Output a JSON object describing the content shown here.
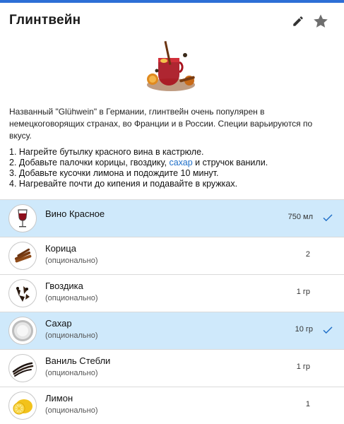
{
  "header": {
    "title": "Глинтвейн",
    "edit_icon": "pencil-icon",
    "star_icon": "star-icon"
  },
  "hero_image": "mulled-wine-photo",
  "description": "Названный \"Glühwein\" в Германии, глинтвейн очень популярен в немецкоговорящих странах, во Франции и в России. Специи варьируются по вкусу.",
  "steps": [
    {
      "prefix": "1. Нагрейте бутылку красного вина в кастрюле.",
      "link": "",
      "suffix": ""
    },
    {
      "prefix": "2. Добавьте палочки корицы, гвоздику, ",
      "link": "сахар",
      "suffix": " и стручок ванили."
    },
    {
      "prefix": "3. Добавьте кусочки лимона и подождите 10 минут.",
      "link": "",
      "suffix": ""
    },
    {
      "prefix": "4. Нагревайте почти до кипения и подавайте в кружках.",
      "link": "",
      "suffix": ""
    }
  ],
  "ingredients": [
    {
      "name": "Вино Красное",
      "note": "",
      "qty": "750 мл",
      "checked": true,
      "icon": "wine-glass-icon"
    },
    {
      "name": "Корица",
      "note": "(опционально)",
      "qty": "2",
      "checked": false,
      "icon": "cinnamon-icon"
    },
    {
      "name": "Гвоздика",
      "note": "(опционально)",
      "qty": "1 гр",
      "checked": false,
      "icon": "clove-icon"
    },
    {
      "name": "Сахар",
      "note": "(опционально)",
      "qty": "10 гр",
      "checked": true,
      "icon": "sugar-icon"
    },
    {
      "name": "Ваниль Стебли",
      "note": "(опционально)",
      "qty": "1 гр",
      "checked": false,
      "icon": "vanilla-icon"
    },
    {
      "name": "Лимон",
      "note": "(опционально)",
      "qty": "1",
      "checked": false,
      "icon": "lemon-icon"
    }
  ],
  "colors": {
    "accent_bar": "#2d6fd6",
    "selected_row": "#cfe9fb",
    "link": "#1f6fc8",
    "check": "#1f6fc8"
  }
}
